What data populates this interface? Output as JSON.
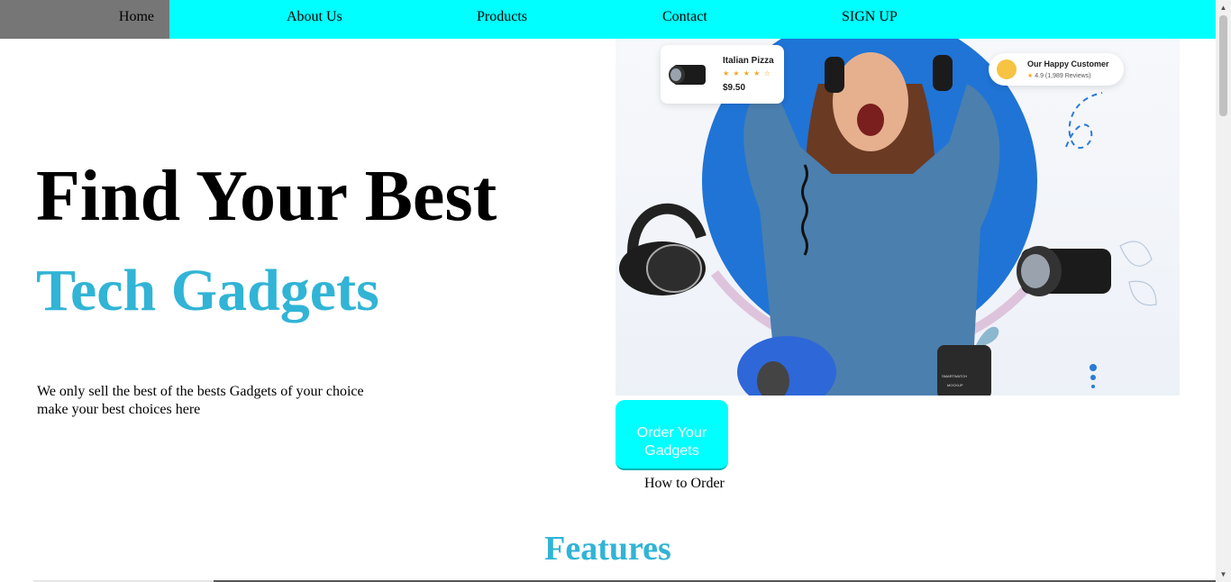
{
  "nav": {
    "items": [
      {
        "label": "Home"
      },
      {
        "label": "About Us"
      },
      {
        "label": "Products"
      },
      {
        "label": "Contact"
      },
      {
        "label": "SIGN UP"
      }
    ]
  },
  "hero": {
    "title": "Find Your Best",
    "subtitle": "Tech Gadgets",
    "description_line1": "We only sell the best of the bests Gadgets of your choice",
    "description_line2": "make your best choices here"
  },
  "hero_image": {
    "product_card": {
      "title": "Italian Pizza",
      "stars": "★ ★ ★ ★ ☆",
      "price": "$9.50"
    },
    "customer_card": {
      "title": "Our Happy Customer",
      "rating": "4.9",
      "reviews": "(1,989 Reviews)"
    },
    "watch_text_1": "SMARTWATCH",
    "watch_text_2": "MOCKUP"
  },
  "order": {
    "button_label": "Order Your Gadgets",
    "how_to_label": "How to Order"
  },
  "features": {
    "heading": "Features"
  },
  "colors": {
    "nav_background": "#00ffff",
    "nav_active": "#767676",
    "accent": "#31b4d6",
    "button": "#00ffff",
    "circle_blue": "#1f74d6"
  },
  "scrollbar": {
    "up_arrow": "▲",
    "down_arrow": "▼"
  }
}
